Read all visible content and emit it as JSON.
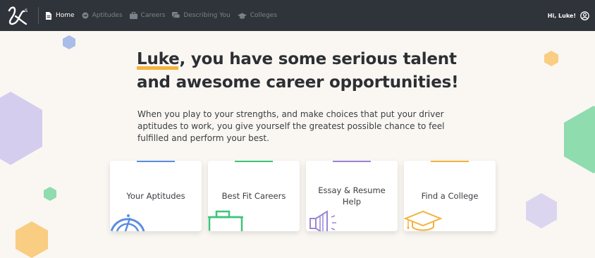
{
  "nav": {
    "items": [
      {
        "label": "Home",
        "icon": "document-icon",
        "active": true
      },
      {
        "label": "Aptitudes",
        "icon": "gauge-icon",
        "active": false
      },
      {
        "label": "Careers",
        "icon": "briefcase-icon",
        "active": false
      },
      {
        "label": "Describing You",
        "icon": "chat-icon",
        "active": false
      },
      {
        "label": "Colleges",
        "icon": "graduation-cap-icon",
        "active": false
      }
    ],
    "greeting": "Hi, Luke!"
  },
  "hero": {
    "name": "Luke",
    "title_rest": ", you have some serious talent and awesome career opportunities!",
    "intro": "When you play to your strengths, and make choices that put your driver aptitudes to work, you give yourself the greatest possible chance to feel fulfilled and perform your best."
  },
  "cards": [
    {
      "label": "Your Aptitudes",
      "accent": "#5b8de0",
      "icon": "gauge-icon"
    },
    {
      "label": "Best Fit Careers",
      "accent": "#3ec47a",
      "icon": "briefcase-icon"
    },
    {
      "label": "Essay & Resume Help",
      "accent": "#9b86d6",
      "icon": "megaphone-icon"
    },
    {
      "label": "Find a College",
      "accent": "#f4b23e",
      "icon": "graduation-cap-icon"
    }
  ],
  "colors": {
    "navbar": "#2f333a",
    "background": "#faf7f2",
    "highlight": "#f4b23e"
  }
}
